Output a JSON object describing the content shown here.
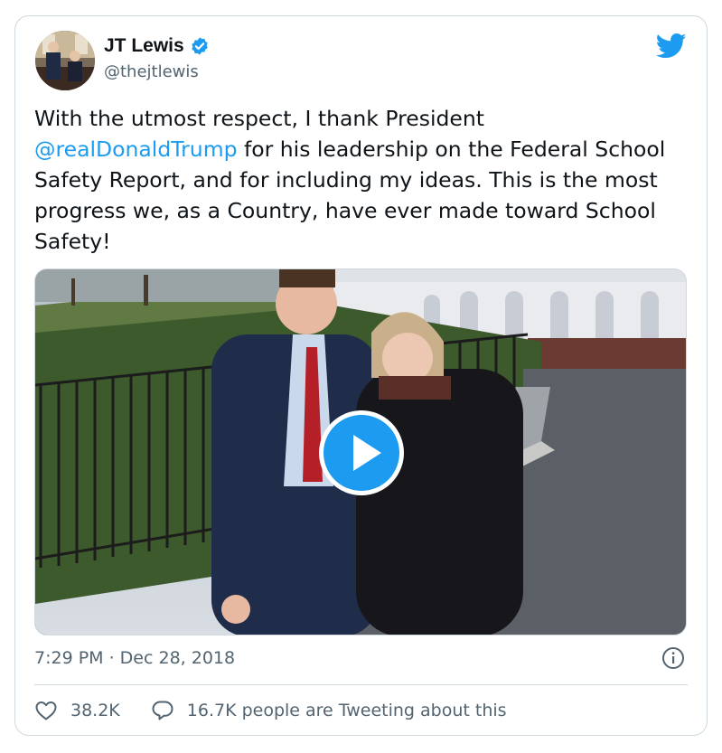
{
  "author": {
    "display_name": "JT Lewis",
    "handle": "@thejtlewis",
    "verified": true,
    "avatar": "avatar-photo"
  },
  "tweet": {
    "text_before": "With the utmost respect, I thank President\n",
    "mention": "@realDonaldTrump",
    "text_after": " for his leadership on the Federal School Safety Report, and for including my ideas. This is the most progress we, as a Country, have ever made toward School Safety!",
    "timestamp": "7:29 PM · Dec 28, 2018"
  },
  "media": {
    "type": "video",
    "icon": "play-icon"
  },
  "stats": {
    "likes": "38.2K",
    "tweeting": "16.7K people are Tweeting about this"
  },
  "icons": {
    "brand": "twitter-bird-icon",
    "info": "info-icon",
    "like": "heart-icon",
    "reply": "comment-icon"
  },
  "colors": {
    "accent": "#1d9bf0",
    "text": "#0f1419",
    "secondary": "#536471",
    "border": "#cfd9de"
  }
}
